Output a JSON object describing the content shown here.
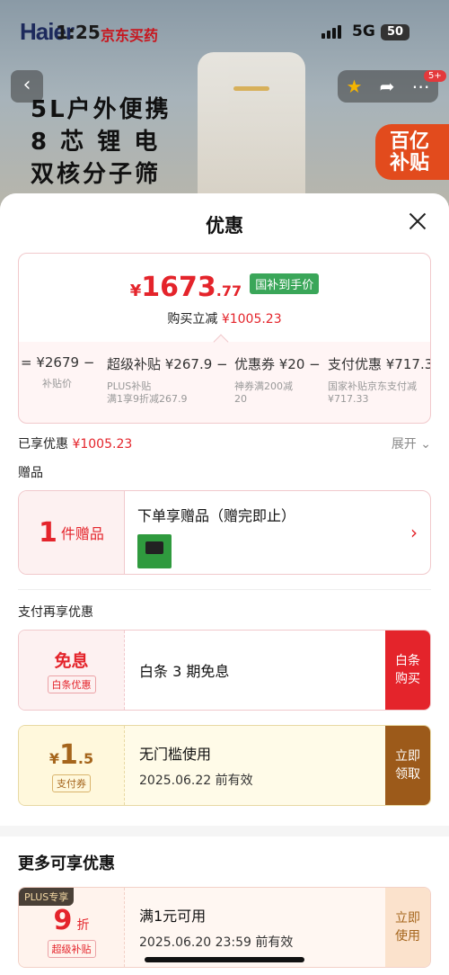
{
  "status_bar": {
    "time": "1:25",
    "network": "5G",
    "battery": "50"
  },
  "background": {
    "brand_logo": "Haier",
    "shop_name": "京东买药",
    "promo_lines": [
      "5L户外便携",
      "8 芯 锂 电",
      "双核分子筛"
    ],
    "badge_lines": [
      "百亿",
      "补贴"
    ],
    "cart_count": "5+"
  },
  "sheet": {
    "title": "优惠",
    "price": {
      "yen": "¥",
      "integer": "1673",
      "decimal": ".77",
      "tag": "国补到手价",
      "reduce_label": "购买立减",
      "reduce_value": "¥1005.23"
    },
    "breakdown": [
      {
        "top": "= ¥2679 −",
        "sub": "补贴价"
      },
      {
        "top": "超级补贴 ¥267.9 −",
        "sub": "PLUS补贴\n满1享9折减267.9"
      },
      {
        "top": "优惠券 ¥20 −",
        "sub": "神券满200减\n20"
      },
      {
        "top": "支付优惠 ¥717.33",
        "sub": "国家补贴京东支付减\n¥717.33"
      }
    ],
    "enjoyed": {
      "label": "已享优惠",
      "value": "¥1005.23",
      "expand": "展开"
    },
    "gift": {
      "section_label": "赠品",
      "count": "1",
      "unit": "件赠品",
      "title": "下单享赠品（赠完即止）"
    },
    "pay_section_label": "支付再享优惠",
    "coupons": [
      {
        "left_main": "免息",
        "left_chip": "白条优惠",
        "title": "白条 3 期免息",
        "subtitle": "",
        "button": "白条\n购买"
      },
      {
        "left_yen": "¥",
        "left_int": "1",
        "left_dec": ".5",
        "left_chip": "支付券",
        "title": "无门槛使用",
        "subtitle": "2025.06.22 前有效",
        "button": "立即\n领取"
      }
    ],
    "more": {
      "title": "更多可享优惠",
      "coupon": {
        "plus_tag": "PLUS专享",
        "left_int": "9",
        "left_unit": "折",
        "left_chip": "超级补贴",
        "title": "满1元可用",
        "subtitle": "2025.06.20 23:59 前有效",
        "button": "立即\n使用"
      }
    }
  },
  "colors": {
    "accent_red": "#e4242b",
    "green_tag": "#3aa659",
    "gold": "#9c5a1a"
  }
}
